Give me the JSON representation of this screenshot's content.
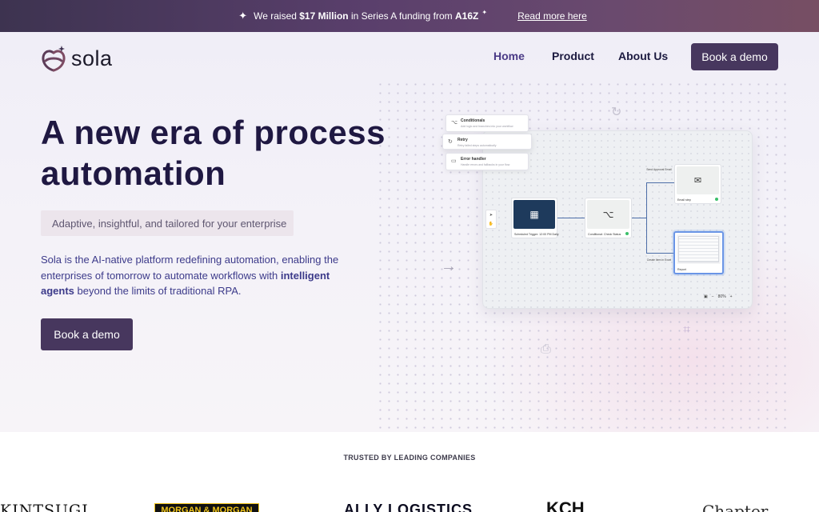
{
  "announcement": {
    "prefix": "We raised ",
    "amount": "$17 Million",
    "middle": " in Series A funding from ",
    "investor": "A16Z",
    "link": "Read more here"
  },
  "nav": {
    "brand": "sola",
    "links": [
      "Home",
      "Product",
      "About Us"
    ],
    "active": "Home",
    "cta": "Book a demo"
  },
  "hero": {
    "title": "A new era of process automation",
    "tagline": "Adaptive, insightful, and tailored for your enterprise",
    "desc_before": "Sola is the AI-native platform redefining automation, enabling the enterprises of tomorrow to automate workflows with ",
    "desc_bold": "intelligent agents",
    "desc_after": " beyond the limits of traditional RPA.",
    "cta": "Book a demo"
  },
  "workflow": {
    "menu": [
      {
        "icon": "⌥",
        "title": "Conditionals",
        "sub": "Add logic and branches into your workflow"
      },
      {
        "icon": "↻",
        "title": "Retry",
        "sub": "Retry failed steps automatically"
      },
      {
        "icon": "▭",
        "title": "Error handler",
        "sub": "Handle errors and fallbacks in your flow"
      }
    ],
    "nodes": {
      "trigger": "Scheduled Trigger: 12:00 PM Daily",
      "check": "Conditional: Check Status",
      "email": "Email step",
      "report": "Report"
    },
    "branch_top": "Send Approval Email",
    "branch_bottom": "Create Item in Excel",
    "zoom": "80%"
  },
  "trusted": {
    "title": "TRUSTED BY LEADING COMPANIES",
    "companies": [
      "KINTSUGI",
      "MORGAN & MORGAN",
      "ALLY LOGISTICS",
      "KCH",
      "Chapter"
    ]
  },
  "colors": {
    "primary": "#47375e",
    "heading": "#1f1842",
    "accent": "#4a3a86"
  }
}
